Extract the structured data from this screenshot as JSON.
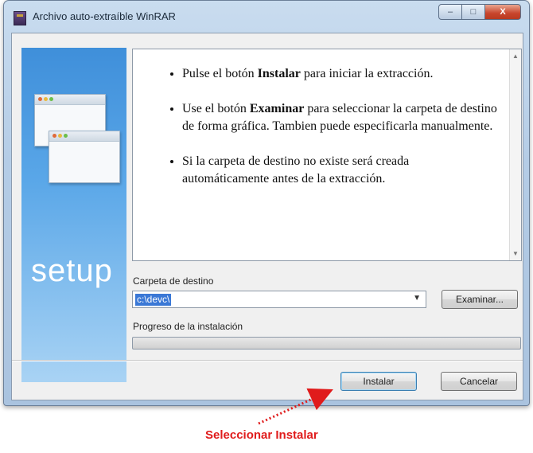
{
  "window": {
    "title": "Archivo auto-extraíble WinRAR",
    "controls": {
      "minimize": "–",
      "maximize": "□",
      "close": "X"
    }
  },
  "banner": {
    "logo_text": "setup"
  },
  "instructions": {
    "item1": {
      "before": "Pulse el botón ",
      "bold": "Instalar",
      "after": " para iniciar la extracción."
    },
    "item2": {
      "before": "Use el botón ",
      "bold": "Examinar",
      "after": " para seleccionar la carpeta de destino de forma gráfica. Tambien puede especificarla manualmente."
    },
    "item3": {
      "text": "Si la carpeta de destino no existe será creada automáticamente antes de la extracción."
    }
  },
  "destination": {
    "label": "Carpeta de destino",
    "value": "c:\\devc\\",
    "browse_label": "Examinar..."
  },
  "progress": {
    "label": "Progreso de la instalación",
    "fraction": 0.0
  },
  "buttons": {
    "install": "Instalar",
    "cancel": "Cancelar"
  },
  "annotation": {
    "text": "Seleccionar Instalar",
    "color": "#e01b1b"
  }
}
